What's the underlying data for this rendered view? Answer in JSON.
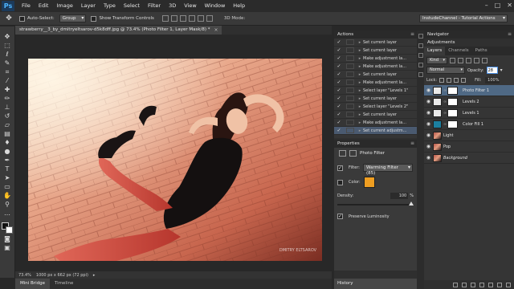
{
  "app": {
    "logo": "Ps",
    "menu": [
      "File",
      "Edit",
      "Image",
      "Layer",
      "Type",
      "Select",
      "Filter",
      "3D",
      "View",
      "Window",
      "Help"
    ],
    "window_controls": [
      "–",
      "□",
      "✕"
    ]
  },
  "options_bar": {
    "tool_icon": "move-tool-icon",
    "auto_select_label": "Auto-Select:",
    "auto_select_value": "Group",
    "show_transform_label": "Show Transform Controls",
    "mode_label": "3D Mode:",
    "workspace": "InstudeChannel - Tutorial Actions"
  },
  "document": {
    "tab_title": "strawberry__3_by_dmitryeltsarov-d5k8dff.jpg @ 73.4% (Photo Filter 1, Layer Mask/8) *",
    "zoom": "73.4%",
    "doc_info": "1000 px x 662 px (72 ppi)",
    "watermark": "DMITRY ELTSAROV"
  },
  "bottom_tabs": [
    "Mini Bridge",
    "Timeline"
  ],
  "actions": {
    "title": "Actions",
    "items": [
      {
        "text": "Set current layer"
      },
      {
        "text": "Set current layer"
      },
      {
        "text": "Make adjustment la..."
      },
      {
        "text": "Make adjustment la..."
      },
      {
        "text": "Set current layer"
      },
      {
        "text": "Make adjustment la..."
      },
      {
        "text": "Select layer \"Levels 1\""
      },
      {
        "text": "Set current layer"
      },
      {
        "text": "Select layer \"Levels 2\""
      },
      {
        "text": "Set current layer"
      },
      {
        "text": "Make adjustment la..."
      },
      {
        "text": "Set current adjustm..."
      }
    ]
  },
  "properties": {
    "title": "Properties",
    "panel_name": "Photo Filter",
    "filter_label": "Filter:",
    "filter_value": "Warming Filter (85)",
    "color_label": "Color:",
    "color_hex": "#ef9e21",
    "density_label": "Density:",
    "density_value": "100",
    "density_unit": "%",
    "preserve_label": "Preserve Luminosity"
  },
  "history_tab": "History",
  "navigator": {
    "title": "Navigator",
    "adjustments": "Adjustments"
  },
  "layers_panel": {
    "tabs": [
      "Layers",
      "Channels",
      "Paths"
    ],
    "kind": "Kind",
    "blend_mode": "Normal",
    "opacity_label": "Opacity:",
    "opacity_value": "28",
    "lock_label": "Lock:",
    "fill_label": "Fill:",
    "fill_value": "100%",
    "layers": [
      {
        "name": "Photo Filter 1",
        "type": "adjustment",
        "selected": true
      },
      {
        "name": "Levels 2",
        "type": "adjustment",
        "selected": false
      },
      {
        "name": "Levels 1",
        "type": "adjustment",
        "selected": false
      },
      {
        "name": "Color Fill 1",
        "type": "fill",
        "selected": false
      },
      {
        "name": "Light",
        "type": "image",
        "selected": false
      },
      {
        "name": "Pop",
        "type": "image",
        "selected": false
      },
      {
        "name": "Background",
        "type": "image",
        "selected": false
      }
    ]
  }
}
